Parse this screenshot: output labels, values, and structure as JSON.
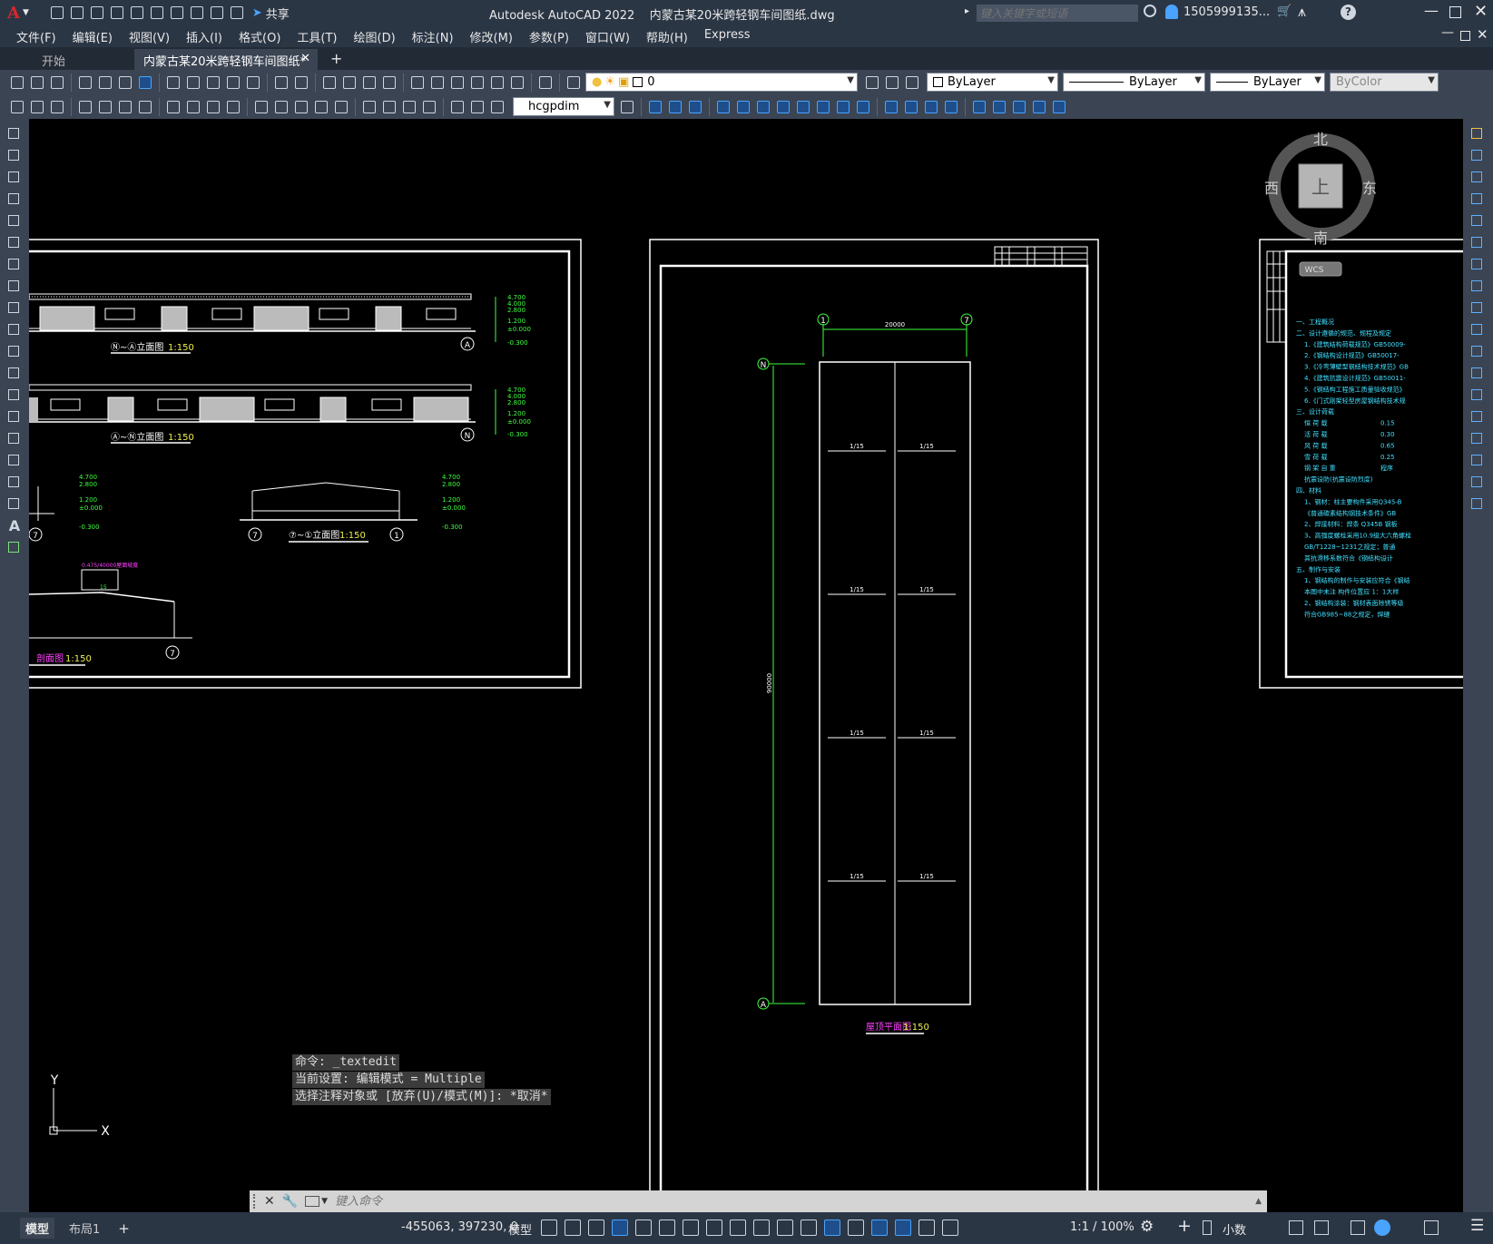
{
  "app": {
    "title": "Autodesk AutoCAD 2022",
    "filename": "内蒙古某20米跨轻钢车间图纸.dwg",
    "share_label": "共享",
    "search_placeholder": "键入关键字或短语",
    "user": "1505999135...",
    "brand_color": "#d9252a"
  },
  "menu": [
    "文件(F)",
    "编辑(E)",
    "视图(V)",
    "插入(I)",
    "格式(O)",
    "工具(T)",
    "绘图(D)",
    "标注(N)",
    "修改(M)",
    "参数(P)",
    "窗口(W)",
    "帮助(H)",
    "Express"
  ],
  "tabs": {
    "start": "开始",
    "active": "内蒙古某20米跨轻钢车间图纸*"
  },
  "properties": {
    "layer": "0",
    "color": "ByLayer",
    "linetype": "ByLayer",
    "lineweight": "ByLayer",
    "plotstyle": "ByColor",
    "dimstyle": "hcgpdim"
  },
  "viewcube": {
    "north": "北",
    "south": "南",
    "east": "东",
    "west": "西",
    "top": "上",
    "wcs": "WCS"
  },
  "drawing": {
    "left_sheet": {
      "title1": "Ⓝ~Ⓐ立面图",
      "scale1": "1:150",
      "title2": "Ⓐ~Ⓝ立面图",
      "scale2": "1:150",
      "title3": "⑦~①立面图",
      "scale3": "1:150",
      "title4": "剖面图",
      "scale4": "1:150",
      "elev": [
        "4.700",
        "4.000",
        "2.800",
        "1.200",
        "±0.000",
        "-0.300"
      ],
      "axis_a": "A",
      "axis_n": "N",
      "axis_1": "1",
      "axis_7": "7",
      "roof_label": "0.475/40000屋面坡度",
      "slope": "15"
    },
    "center_sheet": {
      "dim_top": "20000",
      "dim_left": "90000",
      "axis_1": "1",
      "axis_7": "7",
      "axis_n": "N",
      "axis_a": "A",
      "slope": "1/15",
      "title": "屋顶平面图",
      "scale": "1:150"
    },
    "right_sheet": {
      "lines": [
        "一、工程概况",
        "二、设计遵循的规范、规程及规定",
        "1.《建筑结构荷载规范》GB50009-",
        "2.《钢结构设计规范》GB50017-",
        "3.《冷弯薄壁型钢结构技术规范》GB",
        "4.《建筑抗震设计规范》GB50011-",
        "5.《钢结构工程施工质量验收规范》",
        "6.《门式刚架轻型房屋钢结构技术规",
        "三、设计荷载",
        "恒 荷 载",
        "活 荷 载",
        "风 荷 载",
        "雪 荷 载",
        "钢 架 自 重",
        "抗震设防(抗震设防烈度)",
        "四、材料",
        "1、钢材：柱主要构件采用Q345-B",
        "《普通碳素结构钢技术条件》GB",
        "2、焊接材料：焊条 Q345B 钢板",
        "3、高强度螺栓采用10.9级大六角螺栓",
        "GB/T1228~1231之规定；普通",
        "其抗滑移系数符合《钢结构设计",
        "五、制作与安装",
        "1、钢结构的制作与安装应符合《钢结",
        "本图中未注 构件位置应 1：1大样",
        "2、钢结构涂装：钢材表面除锈等级",
        "符合GB985~88之规定，焊缝"
      ],
      "vals": [
        "0.15",
        "0.30",
        "0.65",
        "0.25",
        "程序"
      ]
    }
  },
  "command": {
    "history": [
      "命令: _textedit",
      "当前设置: 编辑模式 = Multiple",
      "选择注释对象或 [放弃(U)/模式(M)]: *取消*"
    ],
    "placeholder": "键入命令"
  },
  "ucs": {
    "x": "X",
    "y": "Y"
  },
  "status": {
    "model_tab": "模型",
    "layout_tab": "布局1",
    "coords": "-455063, 397230, 0",
    "model": "模型",
    "scale": "1:1 / 100%",
    "units": "小数"
  }
}
